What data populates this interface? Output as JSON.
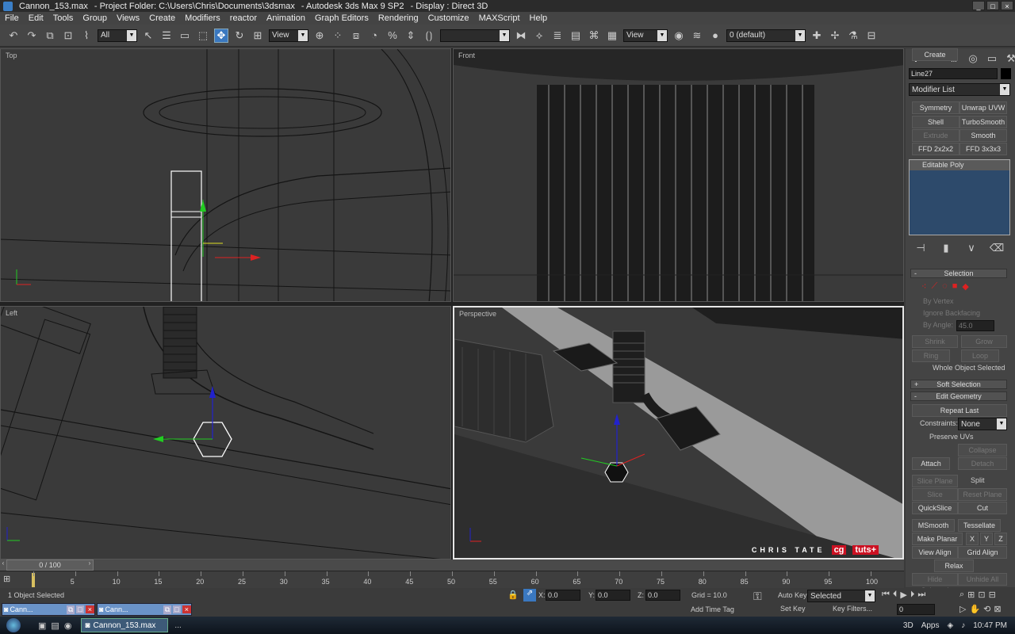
{
  "window": {
    "title": "Cannon_153.max",
    "project": "- Project Folder: C:\\Users\\Chris\\Documents\\3dsmax",
    "app": "- Autodesk 3ds Max 9 SP2",
    "display": "- Display : Direct 3D"
  },
  "menu": [
    "File",
    "Edit",
    "Tools",
    "Group",
    "Views",
    "Create",
    "Modifiers",
    "reactor",
    "Animation",
    "Graph Editors",
    "Rendering",
    "Customize",
    "MAXScript",
    "Help"
  ],
  "toolbar": {
    "filter": "All",
    "refcoord": "View",
    "refcoord2": "View",
    "layer": "0 (default)"
  },
  "viewports": {
    "top": "Top",
    "front": "Front",
    "left": "Left",
    "perspective": "Perspective"
  },
  "panel": {
    "object_name": "Line27",
    "modifier_list": "Modifier List",
    "mod_buttons": [
      "Symmetry",
      "Unwrap UVW",
      "Shell",
      "TurboSmooth",
      "Extrude",
      "Smooth",
      "FFD 2x2x2",
      "FFD 3x3x3"
    ],
    "stack_item": "Editable Poly",
    "selection_title": "Selection",
    "by_vertex": "By Vertex",
    "ignore_backfacing": "Ignore Backfacing",
    "by_angle": "By Angle:",
    "angle_value": "45.0",
    "shrink": "Shrink",
    "grow": "Grow",
    "ring": "Ring",
    "loop": "Loop",
    "whole_selected": "Whole Object Selected",
    "soft_selection": "Soft Selection",
    "edit_geometry": "Edit Geometry",
    "repeat_last": "Repeat Last",
    "constraints_label": "Constraints:",
    "constraints_value": "None",
    "preserve_uvs": "Preserve UVs",
    "create": "Create",
    "collapse": "Collapse",
    "attach": "Attach",
    "detach": "Detach",
    "slice_plane": "Slice Plane",
    "split": "Split",
    "slice": "Slice",
    "reset_plane": "Reset Plane",
    "quickslice": "QuickSlice",
    "cut": "Cut",
    "msmooth": "MSmooth",
    "tessellate": "Tessellate",
    "make_planar": "Make Planar",
    "x": "X",
    "y": "Y",
    "z": "Z",
    "view_align": "View Align",
    "grid_align": "Grid Align",
    "relax": "Relax",
    "hide_selected": "Hide Selected",
    "unhide_all": "Unhide All"
  },
  "watermark": {
    "author": "CHRIS TATE",
    "brand1": "cg",
    "brand2": "tuts+"
  },
  "timeline": {
    "frame": "0 / 100",
    "ticks": [
      "0",
      "5",
      "10",
      "15",
      "20",
      "25",
      "30",
      "35",
      "40",
      "45",
      "50",
      "55",
      "60",
      "65",
      "70",
      "75",
      "80",
      "85",
      "90",
      "95",
      "100"
    ]
  },
  "status": {
    "selected": "1 Object Selected",
    "x_label": "X:",
    "x": "0.0",
    "y_label": "Y:",
    "y": "0.0",
    "z_label": "Z:",
    "z": "0.0",
    "grid": "Grid = 10.0",
    "auto_key": "Auto Key",
    "auto_key_sel": "Selected",
    "set_key": "Set Key",
    "key_filters": "Key Filters...",
    "add_time_tag": "Add Time Tag",
    "frame_field": "0"
  },
  "mini_windows": [
    "Cann...",
    "Cann..."
  ],
  "taskbar": {
    "task": "Cannon_153.max",
    "more": "...",
    "lang": "3D",
    "apps": "Apps",
    "time": "10:47 PM"
  }
}
